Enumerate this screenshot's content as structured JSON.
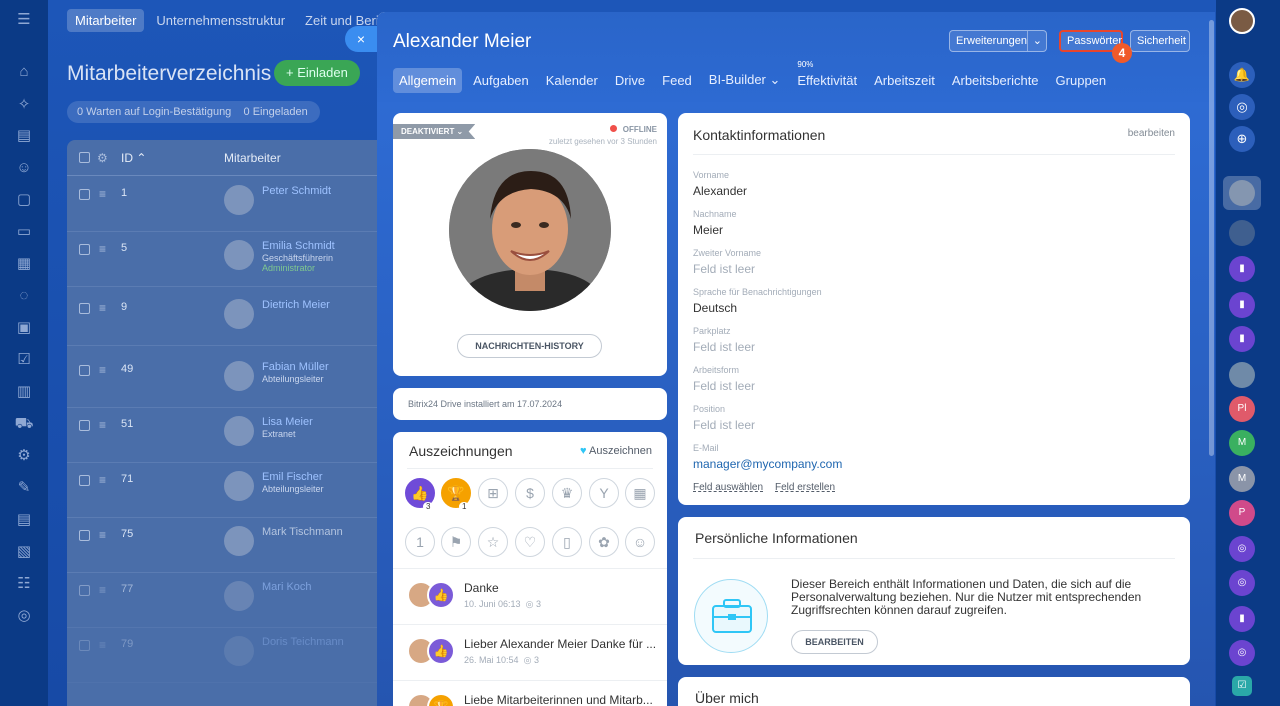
{
  "background": {
    "topnav": [
      "Mitarbeiter",
      "Unternehmensstruktur",
      "Zeit und Berichte"
    ],
    "title": "Mitarbeiterverzeichnis",
    "invite_label": "+ Einladen",
    "filter_waiting": "0 Warten auf Login-Bestätigung",
    "filter_invited": "0 Eingeladen",
    "col_id": "ID ⌃",
    "col_employee": "Mitarbeiter",
    "rows": [
      {
        "id": "1",
        "name": "Peter Schmidt",
        "sub": "",
        "extra": ""
      },
      {
        "id": "5",
        "name": "Emilia Schmidt",
        "sub": "Geschäftsführerin",
        "extra": "Administrator"
      },
      {
        "id": "9",
        "name": "Dietrich Meier",
        "sub": "",
        "extra": ""
      },
      {
        "id": "49",
        "name": "Fabian Müller",
        "sub": "Abteilungsleiter",
        "extra": ""
      },
      {
        "id": "51",
        "name": "Lisa Meier",
        "sub": "Extranet",
        "extra": ""
      },
      {
        "id": "71",
        "name": "Emil Fischer",
        "sub": "Abteilungsleiter",
        "extra": ""
      },
      {
        "id": "75",
        "name": "Mark Tischmann",
        "sub": "",
        "extra": ""
      },
      {
        "id": "77",
        "name": "Mari Koch",
        "sub": "",
        "extra": ""
      },
      {
        "id": "79",
        "name": "Doris Teichmann",
        "sub": "",
        "extra": ""
      }
    ]
  },
  "panel": {
    "close_icon": "×",
    "name": "Alexander Meier",
    "btn_erweiterungen": "Erweiterungen",
    "btn_passwoerter": "Passwörter",
    "btn_sicherheit": "Sicherheit",
    "step_badge": "4",
    "tabs": [
      "Allgemein",
      "Aufgaben",
      "Kalender",
      "Drive",
      "Feed",
      "BI-Builder ⌄",
      "Effektivität",
      "Arbeitszeit",
      "Arbeitsberichte",
      "Gruppen"
    ],
    "efficiency_pct": "90%"
  },
  "profile": {
    "status_tag": "DEAKTIVIERT ⌄",
    "online_status": "OFFLINE",
    "last_seen": "zuletzt gesehen vor 3 Stunden",
    "history_button": "NACHRICHTEN-HISTORY",
    "drive_note": "Bitrix24 Drive installiert am 17.07.2024"
  },
  "awards": {
    "title": "Auszeichnungen",
    "action": "Auszeichnen",
    "count_like": "3",
    "count_cup": "1",
    "feed": [
      {
        "title": "Danke",
        "date": "10. Juni 06:13",
        "views": "3"
      },
      {
        "title": "Lieber Alexander Meier Danke für ...",
        "date": "26. Mai 10:54",
        "views": "3"
      },
      {
        "title": "Liebe Mitarbeiterinnen und Mitarb...",
        "date": "",
        "views": ""
      }
    ]
  },
  "contact": {
    "title": "Kontaktinformationen",
    "edit": "bearbeiten",
    "fields": [
      {
        "label": "Vorname",
        "value": "Alexander"
      },
      {
        "label": "Nachname",
        "value": "Meier"
      },
      {
        "label": "Zweiter Vorname",
        "value": "Feld ist leer"
      },
      {
        "label": "Sprache für Benachrichtigungen",
        "value": "Deutsch"
      },
      {
        "label": "Parkplatz",
        "value": "Feld ist leer"
      },
      {
        "label": "Arbeitsform",
        "value": "Feld ist leer"
      },
      {
        "label": "Position",
        "value": "Feld ist leer"
      },
      {
        "label": "E-Mail",
        "value": "manager@mycompany.com"
      }
    ],
    "select_field": "Feld auswählen",
    "create_field": "Feld erstellen"
  },
  "personal": {
    "title": "Persönliche Informationen",
    "text": "Dieser Bereich enthält Informationen und Daten, die sich auf die Personalverwaltung beziehen. Nur die Nutzer mit entsprechenden Zugriffsrechten können darauf zugreifen.",
    "button": "BEARBEITEN"
  },
  "about": {
    "title": "Über mich"
  },
  "right_avatars": [
    "Pl",
    "M",
    "M",
    "P"
  ]
}
